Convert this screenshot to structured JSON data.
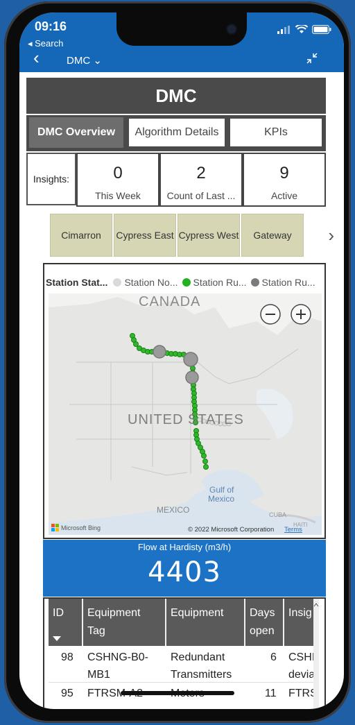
{
  "status_bar": {
    "time": "09:16",
    "back_label": "◂ Search"
  },
  "nav": {
    "title": "DMC ⌄"
  },
  "report": {
    "title": "DMC",
    "tabs": [
      {
        "label": "DMC Overview"
      },
      {
        "label": "Algorithm Details"
      },
      {
        "label": "KPIs"
      }
    ],
    "insights_label": "Insights:",
    "kpis": [
      {
        "value": "0",
        "label": "This Week"
      },
      {
        "value": "2",
        "label": "Count of Last ..."
      },
      {
        "value": "9",
        "label": "Active"
      }
    ],
    "stations": [
      {
        "label": "Cimarron"
      },
      {
        "label": "Cypress East"
      },
      {
        "label": "Cypress West"
      },
      {
        "label": "Gateway"
      }
    ],
    "map": {
      "legend_title": "Station Stat...",
      "legend_items": [
        {
          "label": "Station No...",
          "color": "#d9d9d9"
        },
        {
          "label": "Station Ru...",
          "color": "#22b21e"
        },
        {
          "label": "Station Ru...",
          "color": "#7a7a7a"
        }
      ],
      "labels": {
        "canada": "CANADA",
        "usa": "UNITED STATES",
        "gulf1": "Gulf of",
        "gulf2": "Mexico",
        "mexico": "MEXICO",
        "cuba": "CUBA",
        "haiti": "HAITI"
      },
      "attribution": "© 2022 Microsoft Corporation",
      "terms": "Terms",
      "bing": "Microsoft Bing"
    },
    "flow": {
      "title": "Flow at Hardisty (m3/h)",
      "value": "4403"
    },
    "table": {
      "headers": [
        "ID",
        "Equipment Tag",
        "Equipment",
        "Days open",
        "Insig"
      ],
      "rows": [
        {
          "id": "98",
          "tag1": "CSHNG-B0-",
          "tag2": "MB1",
          "eq1": "Redundant",
          "eq2": "Transmitters",
          "days": "6",
          "ins1": "CSHI",
          "ins2": "devia"
        },
        {
          "id": "95",
          "tag1": "FTRSM-A2",
          "tag2": "",
          "eq1": "Motors",
          "eq2": "",
          "days": "11",
          "ins1": "FTRS",
          "ins2": ""
        }
      ]
    }
  }
}
